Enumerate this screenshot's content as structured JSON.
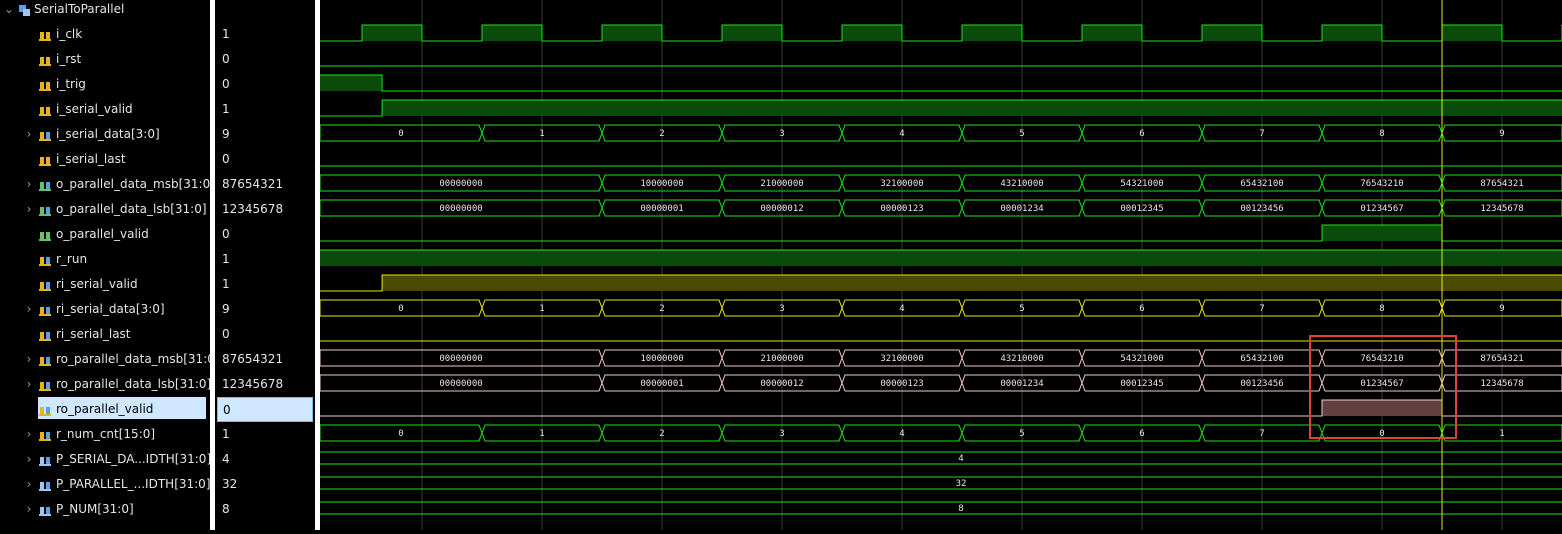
{
  "scope": {
    "name": "SerialToParallel"
  },
  "signals": [
    {
      "name": "i_clk",
      "value": "1",
      "kind": "bit",
      "icon": "input-bit-icon",
      "expandable": false
    },
    {
      "name": "i_rst",
      "value": "0",
      "kind": "bit",
      "icon": "input-bit-icon",
      "expandable": false
    },
    {
      "name": "i_trig",
      "value": "0",
      "kind": "bit",
      "icon": "input-bit-icon",
      "expandable": false
    },
    {
      "name": "i_serial_valid",
      "value": "1",
      "kind": "bit",
      "icon": "input-bit-icon",
      "expandable": false
    },
    {
      "name": "i_serial_data[3:0]",
      "value": "9",
      "kind": "bus",
      "icon": "input-bus-icon",
      "expandable": true
    },
    {
      "name": "i_serial_last",
      "value": "0",
      "kind": "bit",
      "icon": "input-bit-icon",
      "expandable": false
    },
    {
      "name": "o_parallel_data_msb[31:0]",
      "value": "87654321",
      "kind": "bus",
      "icon": "output-bus-icon",
      "expandable": true
    },
    {
      "name": "o_parallel_data_lsb[31:0]",
      "value": "12345678",
      "kind": "bus",
      "icon": "output-bus-icon",
      "expandable": true
    },
    {
      "name": "o_parallel_valid",
      "value": "0",
      "kind": "bit",
      "icon": "output-bit-icon",
      "expandable": false
    },
    {
      "name": "r_run",
      "value": "1",
      "kind": "bit",
      "icon": "register-bit-icon",
      "expandable": false
    },
    {
      "name": "ri_serial_valid",
      "value": "1",
      "kind": "bit",
      "icon": "register-bit-icon",
      "expandable": false
    },
    {
      "name": "ri_serial_data[3:0]",
      "value": "9",
      "kind": "bus",
      "icon": "register-bus-icon",
      "expandable": true
    },
    {
      "name": "ri_serial_last",
      "value": "0",
      "kind": "bit",
      "icon": "register-bit-icon",
      "expandable": false
    },
    {
      "name": "ro_parallel_data_msb[31:0]",
      "value": "87654321",
      "kind": "bus",
      "icon": "register-bus-icon",
      "expandable": true
    },
    {
      "name": "ro_parallel_data_lsb[31:0]",
      "value": "12345678",
      "kind": "bus",
      "icon": "register-bus-icon",
      "expandable": true
    },
    {
      "name": "ro_parallel_valid",
      "value": "0",
      "kind": "bit",
      "icon": "register-bit-icon",
      "expandable": false,
      "selected": true
    },
    {
      "name": "r_num_cnt[15:0]",
      "value": "1",
      "kind": "bus",
      "icon": "register-bus-icon",
      "expandable": true
    },
    {
      "name": "P_SERIAL_DA...IDTH[31:0]",
      "value": "4",
      "kind": "bus",
      "icon": "parameter-icon",
      "expandable": true
    },
    {
      "name": "P_PARALLEL_...IDTH[31:0]",
      "value": "32",
      "kind": "bus",
      "icon": "parameter-icon",
      "expandable": true
    },
    {
      "name": "P_NUM[31:0]",
      "value": "8",
      "kind": "bus",
      "icon": "parameter-icon",
      "expandable": true
    }
  ],
  "waves": {
    "i_clk": {
      "type": "clock",
      "color": "#19e619"
    },
    "i_rst": {
      "type": "bit",
      "color": "#19e619",
      "segments": [
        [
          0,
          1,
          0
        ]
      ]
    },
    "i_trig": {
      "type": "bit",
      "color": "#19e619",
      "segments": [
        [
          0,
          0.05,
          1
        ],
        [
          0.05,
          1,
          0
        ]
      ]
    },
    "i_serial_valid": {
      "type": "bit",
      "color": "#19e619",
      "segments": [
        [
          0,
          0.05,
          0
        ],
        [
          0.05,
          1,
          1
        ]
      ]
    },
    "i_serial_data": {
      "type": "bus",
      "color": "#19e619",
      "labels": [
        "0",
        "1",
        "2",
        "3",
        "4",
        "5",
        "6",
        "7",
        "8",
        "9"
      ]
    },
    "i_serial_last": {
      "type": "bit",
      "color": "#19e619",
      "segments": [
        [
          0,
          1,
          0
        ]
      ]
    },
    "o_parallel_data_msb": {
      "type": "bus",
      "color": "#19e619",
      "labels": [
        "00000000",
        "10000000",
        "21000000",
        "32100000",
        "43210000",
        "54321000",
        "65432100",
        "76543210",
        "87654321"
      ]
    },
    "o_parallel_data_lsb": {
      "type": "bus",
      "color": "#19e619",
      "labels": [
        "00000000",
        "00000001",
        "00000012",
        "00000123",
        "00001234",
        "00012345",
        "00123456",
        "01234567",
        "12345678"
      ]
    },
    "o_parallel_valid": {
      "type": "bit",
      "color": "#19e619",
      "segments": [
        [
          0,
          8,
          0
        ],
        [
          8,
          9,
          1
        ],
        [
          9,
          10,
          0
        ]
      ]
    },
    "r_run": {
      "type": "bit",
      "color": "#19e619",
      "segments": [
        [
          0,
          1,
          1
        ]
      ]
    },
    "ri_serial_valid": {
      "type": "bit",
      "color": "#e6e619",
      "segments": [
        [
          0,
          0.05,
          0
        ],
        [
          0.05,
          1,
          1
        ]
      ]
    },
    "ri_serial_data": {
      "type": "bus",
      "color": "#e6e619",
      "labels": [
        "0",
        "1",
        "2",
        "3",
        "4",
        "5",
        "6",
        "7",
        "8",
        "9"
      ]
    },
    "ri_serial_last": {
      "type": "bit",
      "color": "#e6e619",
      "segments": [
        [
          0,
          1,
          0
        ]
      ]
    },
    "ro_parallel_data_msb": {
      "type": "bus",
      "color": "#f0c8c8",
      "labels": [
        "00000000",
        "10000000",
        "21000000",
        "32100000",
        "43210000",
        "54321000",
        "65432100",
        "76543210",
        "87654321"
      ]
    },
    "ro_parallel_data_lsb": {
      "type": "bus",
      "color": "#f0c8c8",
      "labels": [
        "00000000",
        "00000001",
        "00000012",
        "00000123",
        "00001234",
        "00012345",
        "00123456",
        "01234567",
        "12345678"
      ]
    },
    "ro_parallel_valid": {
      "type": "bit",
      "color": "#f0c8c8",
      "segments": [
        [
          0,
          8,
          0
        ],
        [
          8,
          9,
          1
        ],
        [
          9,
          10,
          0
        ]
      ]
    },
    "r_num_cnt": {
      "type": "bus",
      "color": "#19e619",
      "labels": [
        "0",
        "1",
        "2",
        "3",
        "4",
        "5",
        "6",
        "7",
        "0",
        "1"
      ]
    },
    "P_SERIAL_DATA_WIDTH": {
      "type": "const",
      "color": "#19e619",
      "label": "4"
    },
    "P_PARALLEL_DATA_WIDTH": {
      "type": "const",
      "color": "#19e619",
      "label": "32"
    },
    "P_NUM": {
      "type": "const",
      "color": "#19e619",
      "label": "8"
    }
  },
  "colors": {
    "grid": "#3c3c3c",
    "cursor": "#e6e619",
    "highlight": "#e04040",
    "selection": "#cfe7ff"
  }
}
